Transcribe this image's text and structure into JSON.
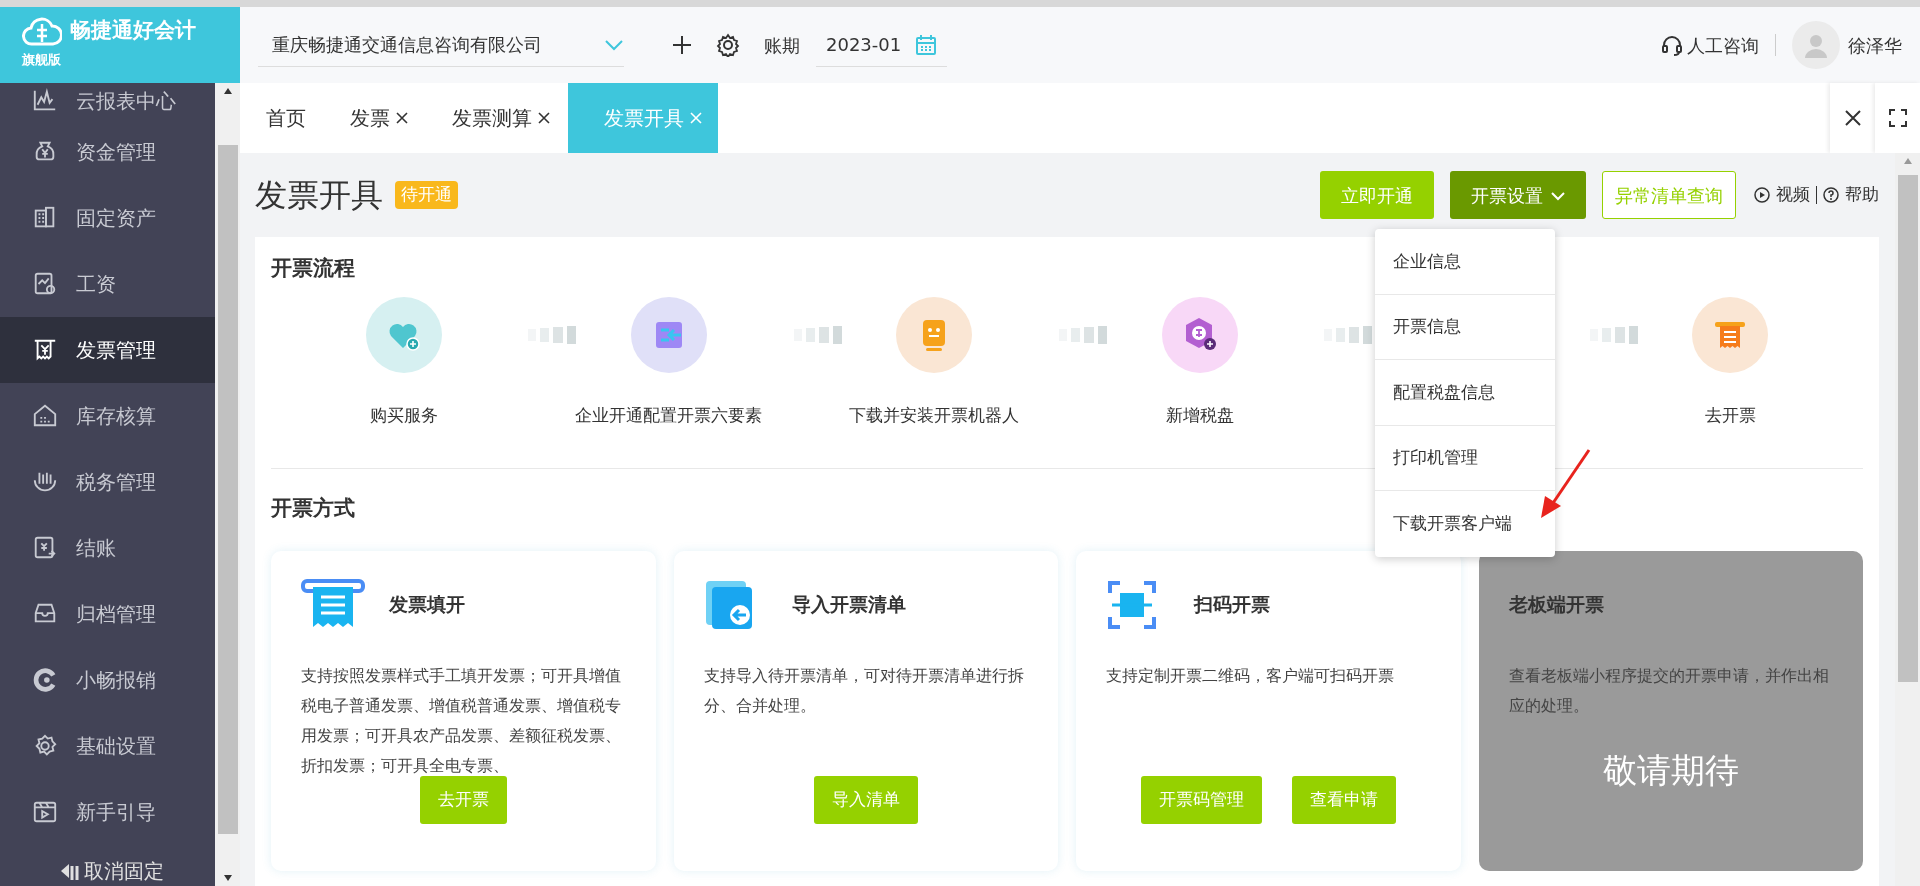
{
  "app": {
    "name": "畅捷通好会计",
    "edition": "旗舰版"
  },
  "topbar": {
    "company": "重庆畅捷通交通信息咨询有限公司",
    "period_label": "账期",
    "period": "2023-01",
    "support": "人工咨询",
    "user": "徐泽华"
  },
  "sidebar": {
    "items": [
      {
        "label": "云报表中心",
        "selected": false
      },
      {
        "label": "资金管理",
        "selected": false
      },
      {
        "label": "固定资产",
        "selected": false
      },
      {
        "label": "工资",
        "selected": false
      },
      {
        "label": "发票管理",
        "selected": true
      },
      {
        "label": "库存核算",
        "selected": false
      },
      {
        "label": "税务管理",
        "selected": false
      },
      {
        "label": "结账",
        "selected": false
      },
      {
        "label": "归档管理",
        "selected": false
      },
      {
        "label": "小畅报销",
        "selected": false
      },
      {
        "label": "基础设置",
        "selected": false
      },
      {
        "label": "新手引导",
        "selected": false
      }
    ],
    "unpin": "取消固定"
  },
  "tabs": [
    {
      "label": "首页",
      "closable": false,
      "selected": false
    },
    {
      "label": "发票",
      "closable": true,
      "selected": false
    },
    {
      "label": "发票测算",
      "closable": true,
      "selected": false
    },
    {
      "label": "发票开具",
      "closable": true,
      "selected": true
    }
  ],
  "page": {
    "title": "发票开具",
    "badge": "待开通",
    "buttons": [
      {
        "label": "立即开通",
        "kind": "primary"
      },
      {
        "label": "开票设置",
        "kind": "dropdown"
      },
      {
        "label": "异常清单查询",
        "kind": "outline"
      }
    ],
    "video": "视频",
    "help": "帮助"
  },
  "dropdown": {
    "items": [
      "企业信息",
      "开票信息",
      "配置税盘信息",
      "打印机管理",
      "下载开票客户端"
    ]
  },
  "flow": {
    "title": "开票流程",
    "steps": [
      {
        "label": "购买服务",
        "color": "#d6f0f1"
      },
      {
        "label": "企业开通配置开票六要素",
        "color": "#e0e0f8"
      },
      {
        "label": "下载并安装开票机器人",
        "color": "#fae6d4"
      },
      {
        "label": "新增税盘",
        "color": "#f8d8f7"
      },
      {
        "label": "去开票",
        "color": "#fae6d4"
      }
    ]
  },
  "methods": {
    "title": "开票方式",
    "cards": [
      {
        "kind": "active",
        "title": "发票填开",
        "desc": "支持按照发票样式手工填开发票；可开具增值税电子普通发票、增值税普通发票、增值税专用发票；可开具农产品发票、差额征税发票、折扣发票；可开具全电专票、",
        "buttons": [
          "去开票"
        ]
      },
      {
        "kind": "active",
        "title": "导入开票清单",
        "desc": "支持导入待开票清单，可对待开票清单进行拆分、合并处理。",
        "buttons": [
          "导入清单"
        ]
      },
      {
        "kind": "active",
        "title": "扫码开票",
        "desc": "支持定制开票二维码，客户端可扫码开票",
        "buttons": [
          "开票码管理",
          "查看申请"
        ]
      },
      {
        "kind": "disabled",
        "title": "老板端开票",
        "desc": "查看老板端小程序提交的开票申请，并作出相应的处理。",
        "overlay": "敬请期待"
      }
    ]
  }
}
